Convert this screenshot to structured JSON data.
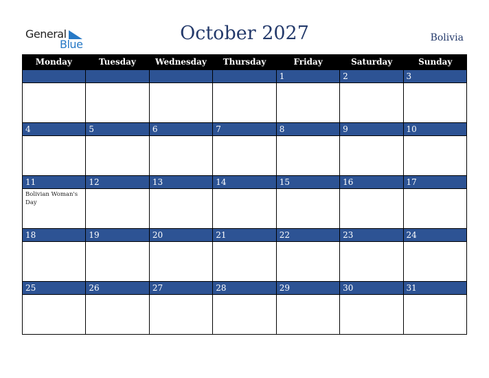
{
  "logo": {
    "word1": "General",
    "word2": "Blue"
  },
  "title": "October 2027",
  "country": "Bolivia",
  "colors": {
    "header_bg": "#000000",
    "band": "#2d5394",
    "title": "#243a6b",
    "logo_blue": "#2779c6"
  },
  "weekdays": [
    "Monday",
    "Tuesday",
    "Wednesday",
    "Thursday",
    "Friday",
    "Saturday",
    "Sunday"
  ],
  "weeks": [
    [
      {
        "day": ""
      },
      {
        "day": ""
      },
      {
        "day": ""
      },
      {
        "day": ""
      },
      {
        "day": "1"
      },
      {
        "day": "2"
      },
      {
        "day": "3"
      }
    ],
    [
      {
        "day": "4"
      },
      {
        "day": "5"
      },
      {
        "day": "6"
      },
      {
        "day": "7"
      },
      {
        "day": "8"
      },
      {
        "day": "9"
      },
      {
        "day": "10"
      }
    ],
    [
      {
        "day": "11",
        "event": "Bolivian Woman's Day"
      },
      {
        "day": "12"
      },
      {
        "day": "13"
      },
      {
        "day": "14"
      },
      {
        "day": "15"
      },
      {
        "day": "16"
      },
      {
        "day": "17"
      }
    ],
    [
      {
        "day": "18"
      },
      {
        "day": "19"
      },
      {
        "day": "20"
      },
      {
        "day": "21"
      },
      {
        "day": "22"
      },
      {
        "day": "23"
      },
      {
        "day": "24"
      }
    ],
    [
      {
        "day": "25"
      },
      {
        "day": "26"
      },
      {
        "day": "27"
      },
      {
        "day": "28"
      },
      {
        "day": "29"
      },
      {
        "day": "30"
      },
      {
        "day": "31"
      }
    ]
  ]
}
